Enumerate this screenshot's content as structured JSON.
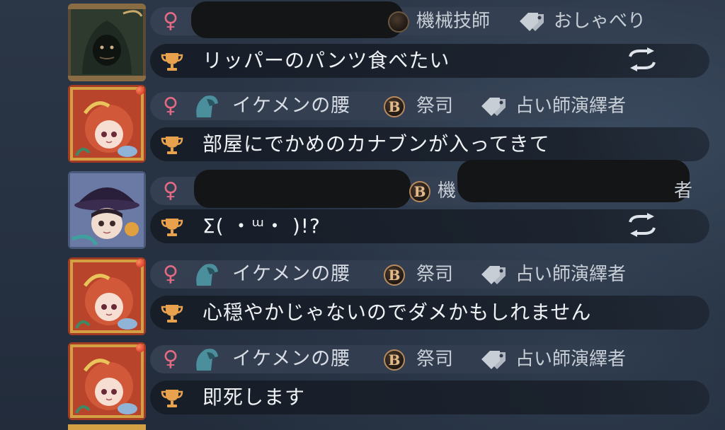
{
  "messages": [
    {
      "avatar": "hooded-survivor-avatar",
      "gender_symbol": "♀",
      "name": "",
      "name_redacted": true,
      "badge_letter": "",
      "role": "機械技師",
      "role_redacted": false,
      "tag": "おしゃべり",
      "tag_redacted": false,
      "text": "リッパーのパンツ食べたい",
      "swap_icon": true
    },
    {
      "avatar": "red-haired-priestess-avatar",
      "gender_symbol": "♀",
      "name": "イケメンの腰",
      "name_redacted": false,
      "badge_letter": "B",
      "role": "祭司",
      "role_redacted": false,
      "tag": "占い師演繹者",
      "tag_redacted": false,
      "text": "部屋にでかめのカナブンが入ってきて",
      "swap_icon": false
    },
    {
      "avatar": "witch-hat-avatar",
      "gender_symbol": "♀",
      "name": "",
      "name_redacted": true,
      "badge_letter": "B",
      "role": "機",
      "role_redacted": true,
      "tag": "者",
      "tag_redacted": true,
      "text": "Σ( ・ᵚ・ )!?",
      "swap_icon": true
    },
    {
      "avatar": "red-haired-priestess-avatar",
      "gender_symbol": "♀",
      "name": "イケメンの腰",
      "name_redacted": false,
      "badge_letter": "B",
      "role": "祭司",
      "role_redacted": false,
      "tag": "占い師演繹者",
      "tag_redacted": false,
      "text": "心穏やかじゃないのでダメかもしれません",
      "swap_icon": false
    },
    {
      "avatar": "red-haired-priestess-avatar",
      "gender_symbol": "♀",
      "name": "イケメンの腰",
      "name_redacted": false,
      "badge_letter": "B",
      "role": "祭司",
      "role_redacted": false,
      "tag": "占い師演繹者",
      "tag_redacted": false,
      "text": "即死します",
      "swap_icon": false
    }
  ],
  "colors": {
    "gender": "#e26a83",
    "trophy": "#e8a24e",
    "helmet": "#4b8f9c",
    "badge_ring": "#b68a5c"
  }
}
